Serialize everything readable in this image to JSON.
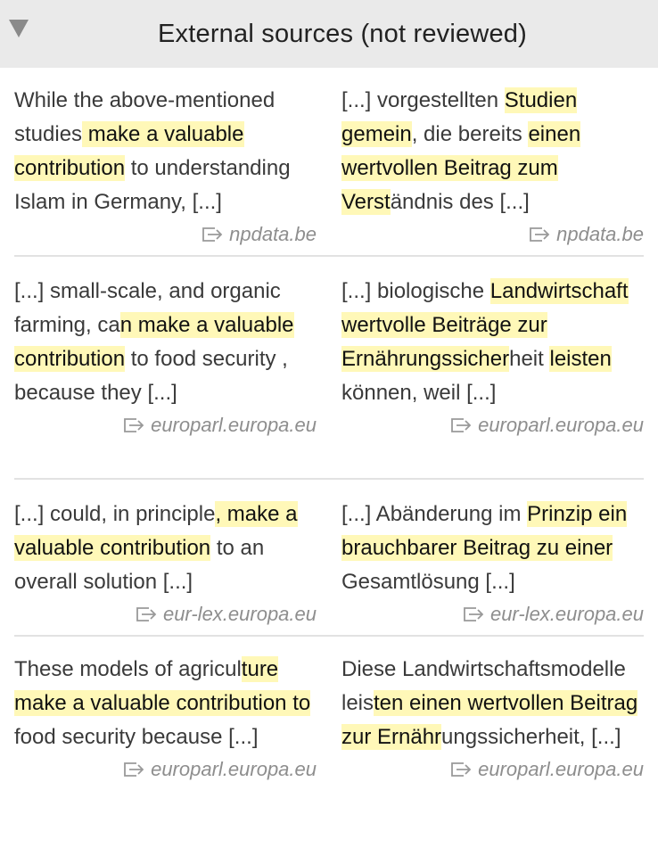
{
  "header": {
    "title": "External sources (not reviewed)"
  },
  "pairs": [
    {
      "en": [
        {
          "t": "While the above-mentioned studies",
          "h": false
        },
        {
          "t": " make a valuable contribution",
          "h": true
        },
        {
          "t": " to understanding Islam in Germany, [...]",
          "h": false
        }
      ],
      "de": [
        {
          "t": "[...] vorgestellten ",
          "h": false
        },
        {
          "t": "Studien gemein",
          "h": true
        },
        {
          "t": ", die bereits ",
          "h": false
        },
        {
          "t": "einen wertvollen Beitrag zum Verst",
          "h": true
        },
        {
          "t": "ändnis des [...]",
          "h": false
        }
      ],
      "src_en": "npdata.be",
      "src_de": "npdata.be"
    },
    {
      "en": [
        {
          "t": "[...] small-scale, and organic farming, ca",
          "h": false
        },
        {
          "t": "n make a valuable contribution",
          "h": true
        },
        {
          "t": " to food security , because they [...]",
          "h": false
        }
      ],
      "de": [
        {
          "t": "[...] biologische ",
          "h": false
        },
        {
          "t": "Landwirtschaft wertvolle Beiträge zur Ernährungssicher",
          "h": true
        },
        {
          "t": "heit ",
          "h": false
        },
        {
          "t": "leisten",
          "h": true
        },
        {
          "t": " können, weil [...]",
          "h": false
        }
      ],
      "src_en": "europarl.europa.eu",
      "src_de": "europarl.europa.eu"
    },
    {
      "en": [
        {
          "t": "[...] could, in principle",
          "h": false
        },
        {
          "t": ", make a valuable contribution",
          "h": true
        },
        {
          "t": " to an overall solution [...]",
          "h": false
        }
      ],
      "de": [
        {
          "t": "[...] Abänderung im ",
          "h": false
        },
        {
          "t": "Prinzip ein brauchbarer Beitrag zu einer",
          "h": true
        },
        {
          "t": " Gesamtlösung [...]",
          "h": false
        }
      ],
      "src_en": "eur-lex.europa.eu",
      "src_de": "eur-lex.europa.eu"
    },
    {
      "en": [
        {
          "t": "These models of agricul",
          "h": false
        },
        {
          "t": "ture make a valuable contribution to",
          "h": true
        },
        {
          "t": " food security because [...]",
          "h": false
        }
      ],
      "de": [
        {
          "t": "Diese Landwirtschaftsmodelle leis",
          "h": false
        },
        {
          "t": "ten einen wertvollen Beitrag zur Ernähr",
          "h": true
        },
        {
          "t": "ungssicherheit, [...]",
          "h": false
        }
      ],
      "src_en": "europarl.europa.eu",
      "src_de": "europarl.europa.eu"
    }
  ]
}
